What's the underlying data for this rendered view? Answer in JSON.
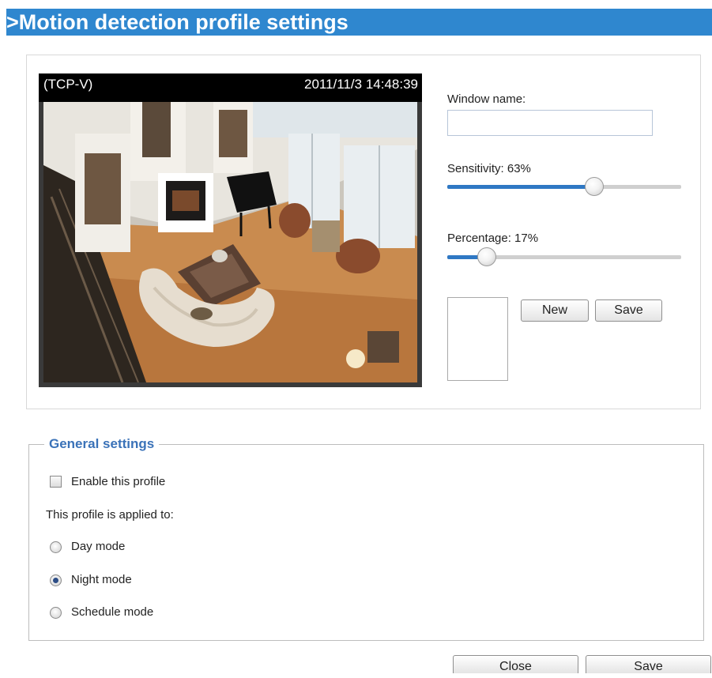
{
  "header": {
    "title": ">Motion detection profile settings"
  },
  "video": {
    "stream_label": "(TCP-V)",
    "timestamp": "2011/11/3 14:48:39"
  },
  "window_name": {
    "label": "Window name:",
    "value": ""
  },
  "sensitivity": {
    "label": "Sensitivity: 63%",
    "value_percent": 63
  },
  "percentage": {
    "label": "Percentage: 17%",
    "value_percent": 17
  },
  "window_buttons": {
    "new_label": "New",
    "save_label": "Save"
  },
  "general": {
    "legend": "General settings",
    "enable_label": "Enable this profile",
    "enable_checked": false,
    "applied_to_label": "This profile is applied to:",
    "modes": [
      {
        "label": "Day mode",
        "checked": false
      },
      {
        "label": "Night mode",
        "checked": true
      },
      {
        "label": "Schedule mode",
        "checked": false
      }
    ]
  },
  "footer": {
    "close_label": "Close",
    "save_label": "Save"
  },
  "colors": {
    "accent": "#2f87cf",
    "slider_fill": "#2f78c4",
    "legend": "#3a72b8"
  }
}
